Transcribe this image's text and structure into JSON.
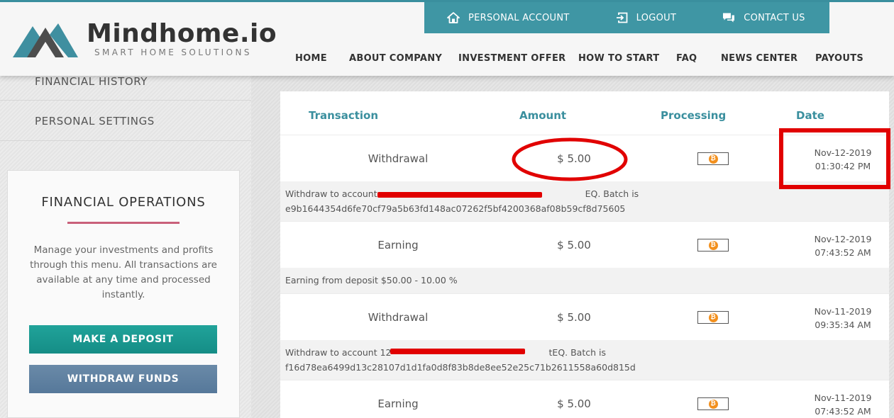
{
  "header": {
    "brand_name": "Mindhome.io",
    "brand_tagline": "SMART HOME SOLUTIONS",
    "top_links": {
      "personal_account": "PERSONAL ACCOUNT",
      "logout": "LOGOUT",
      "contact_us": "CONTACT US"
    },
    "nav": {
      "home": "HOME",
      "about_company": "ABOUT COMPANY",
      "investment_offer": "INVESTMENT OFFER",
      "how_to_start": "HOW TO START",
      "faq": "FAQ",
      "news_center": "NEWS CENTER",
      "payouts": "PAYOUTS"
    },
    "colors": {
      "accent": "#3f96a4",
      "nav_text": "#333333"
    }
  },
  "sidebar": {
    "menu": {
      "financial_history": "FINANCIAL HISTORY",
      "personal_settings": "PERSONAL SETTINGS"
    },
    "financial_operations": {
      "title": "FINANCIAL OPERATIONS",
      "description": "Manage your investments and profits through this menu. All transactions are available at any time and processed instantly.",
      "deposit_button": "MAKE A DEPOSIT",
      "withdraw_button": "WITHDRAW FUNDS"
    }
  },
  "table": {
    "headers": {
      "transaction": "Transaction",
      "amount": "Amount",
      "processing": "Processing",
      "date": "Date"
    },
    "rows": [
      {
        "type": "Withdrawal",
        "amount": "$ 5.00",
        "processing_icon": "bitcoin-icon",
        "date": "Nov-12-2019",
        "time": "01:30:42 PM",
        "desc_line1_start": "Withdraw to account ",
        "desc_line1_end": "EQ. Batch is",
        "desc_line2": "e9b1644354d6fe70cf79a5b63fd148ac07262f5bf4200368af08b59cf8d75605"
      },
      {
        "type": "Earning",
        "amount": "$ 5.00",
        "processing_icon": "bitcoin-icon",
        "date": "Nov-12-2019",
        "time": "07:43:52 AM",
        "desc_line1": "Earning from deposit $50.00 - 10.00 %"
      },
      {
        "type": "Withdrawal",
        "amount": "$ 5.00",
        "processing_icon": "bitcoin-icon",
        "date": "Nov-11-2019",
        "time": "09:35:34 AM",
        "desc_line1_start": "Withdraw to account 12",
        "desc_line1_end": "tEQ. Batch is",
        "desc_line2": "f16d78ea6499d13c28107d1d1fa0d8f83b8de8ee52e25c71b2611558a60d815d"
      },
      {
        "type": "Earning",
        "amount": "$ 5.00",
        "processing_icon": "bitcoin-icon",
        "date": "Nov-11-2019",
        "time": "07:43:52 AM"
      }
    ]
  },
  "annotations": {
    "highlight_color": "#e10000"
  }
}
